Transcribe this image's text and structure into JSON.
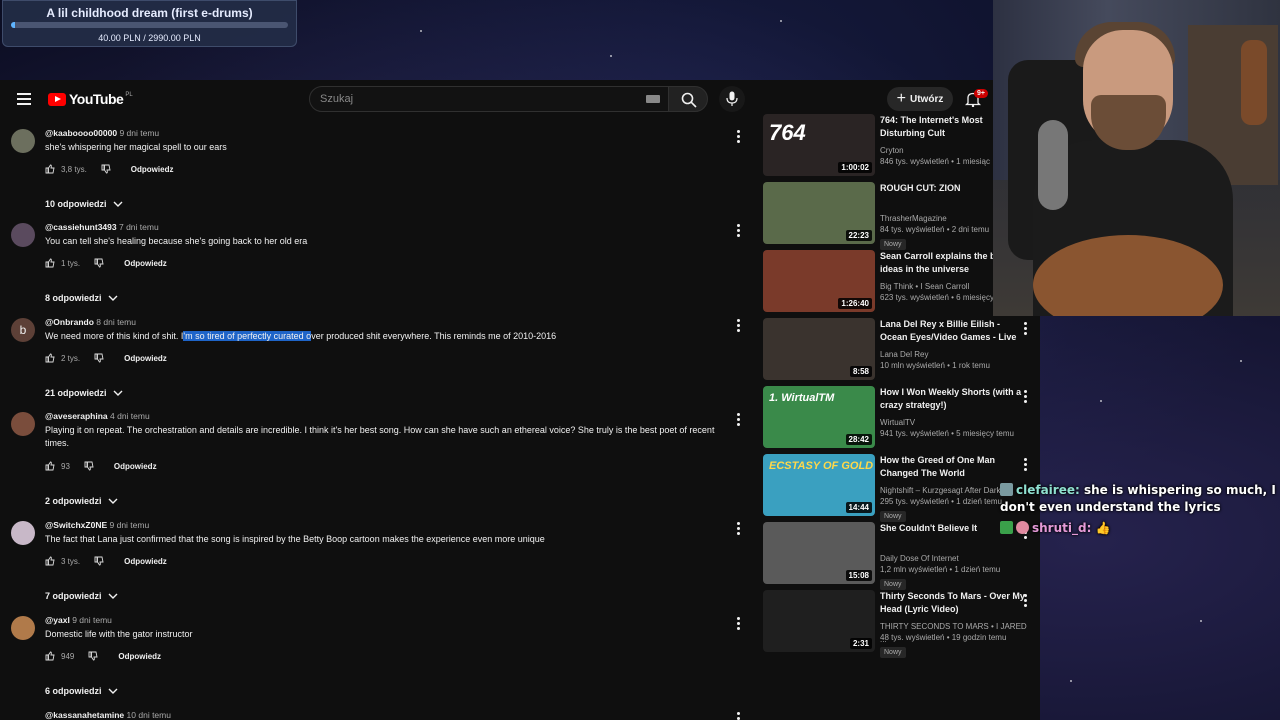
{
  "goal": {
    "title": "A lil childhood dream (first e-drums)",
    "amount": "40.00 PLN / 2990.00 PLN",
    "progress_fraction": 0.0134
  },
  "masthead": {
    "logo_text": "YouTube",
    "region": "PL",
    "search_placeholder": "Szukaj",
    "create_label": "Utwórz",
    "notifications_badge": "9+"
  },
  "comments": [
    {
      "author": "@kaaboooo00000",
      "time": "9 dni temu",
      "text": "she's whispering her magical spell to our ears",
      "likes": "3,8 tys.",
      "reply_label": "Odpowiedz",
      "replies": "10 odpowiedzi",
      "avatar_color": "#6c6f5e"
    },
    {
      "author": "@cassiehunt3493",
      "time": "7 dni temu",
      "text": "You can tell she's healing because she's going back to her old era",
      "likes": "1 tys.",
      "reply_label": "Odpowiedz",
      "replies": "8 odpowiedzi",
      "avatar_color": "#5a4a5e"
    },
    {
      "author": "@Onbrando",
      "time": "8 dni temu",
      "text_before": "We need more of this kind of shit. I",
      "text_highlight": "'m so tired of perfectly curated o",
      "text_after": "ver produced shit everywhere. This reminds me of 2010-2016",
      "likes": "2 tys.",
      "reply_label": "Odpowiedz",
      "replies": "21 odpowiedzi",
      "avatar_letter": "b",
      "avatar_color": "#5d4037"
    },
    {
      "author": "@aveseraphina",
      "time": "4 dni temu",
      "text": "Playing it on repeat. The orchestration and details are incredible. I think it's her best song. How can she have such an ethereal voice? She truly is the best poet of recent times.",
      "likes": "93",
      "reply_label": "Odpowiedz",
      "replies": "2 odpowiedzi",
      "avatar_color": "#7a4d3c"
    },
    {
      "author": "@SwitchxZ0NE",
      "time": "9 dni temu",
      "text": "The fact that Lana just confirmed that the song is inspired by the Betty Boop cartoon makes the experience even more unique",
      "likes": "3 tys.",
      "reply_label": "Odpowiedz",
      "replies": "7 odpowiedzi",
      "avatar_color": "#c8b8c8"
    },
    {
      "author": "@yaxl",
      "time": "9 dni temu",
      "text": "Domestic life with the gator instructor",
      "likes": "949",
      "reply_label": "Odpowiedz",
      "replies": "6 odpowiedzi",
      "avatar_color": "#b07a4a"
    },
    {
      "author": "@kassanahetamine",
      "time": "10 dni temu"
    }
  ],
  "recommendations": [
    {
      "title": "764: The Internet's Most Disturbing Cult",
      "channel": "Cryton",
      "meta": "846 tys. wyświetleń • 1 miesiąc",
      "duration": "1:00:02",
      "thumb_color": "#2a2424",
      "thumb_text": "764"
    },
    {
      "title": "ROUGH CUT: ZION",
      "channel": "ThrasherMagazine",
      "meta": "84 tys. wyświetleń • 2 dni temu",
      "duration": "22:23",
      "new": "Nowy",
      "thumb_color": "#5a6a4a"
    },
    {
      "title": "Sean Carroll explains the biggest ideas in the universe",
      "channel": "Big Think • I Sean Carroll",
      "meta": "623 tys. wyświetleń • 6 miesięcy",
      "duration": "1:26:40",
      "thumb_color": "#7a3a2a"
    },
    {
      "title": "Lana Del Rey x Billie Eilish - Ocean Eyes/Video Games - Live",
      "channel": "Lana Del Rey",
      "meta": "10 mln wyświetleń • 1 rok temu",
      "duration": "8:58",
      "thumb_color": "#3a332e"
    },
    {
      "title": "How I Won Weekly Shorts (with a crazy strategy!)",
      "channel": "WirtualTV",
      "meta": "941 tys. wyświetleń • 5 miesięcy temu",
      "duration": "28:42",
      "thumb_color": "#3a8a4a",
      "thumb_text": "1. WirtualTM"
    },
    {
      "title": "How the Greed of One Man Changed The World",
      "channel": "Nightshift – Kurzgesagt After Dark",
      "meta": "295 tys. wyświetleń • 1 dzień temu",
      "duration": "14:44",
      "new": "Nowy",
      "thumb_color": "#3aa0c0",
      "thumb_text": "ECSTASY OF GOLD"
    },
    {
      "title": "She Couldn't Believe It",
      "channel": "Daily Dose Of Internet",
      "meta": "1,2 mln wyświetleń • 1 dzień temu",
      "duration": "15:08",
      "new": "Nowy",
      "thumb_color": "#5a5a5a"
    },
    {
      "title": "Thirty Seconds To Mars - Over My Head (Lyric Video)",
      "channel": "THIRTY SECONDS TO MARS • I JARED ...",
      "meta": "48 tys. wyświetleń • 19 godzin temu",
      "duration": "2:31",
      "new": "Nowy",
      "thumb_color": "#1f1f1f"
    }
  ],
  "chat": [
    {
      "user": "clefairee:",
      "message": "she is whispering so much, I don't even understand the lyrics"
    },
    {
      "user": "shruti_d:",
      "message": "👍"
    }
  ]
}
